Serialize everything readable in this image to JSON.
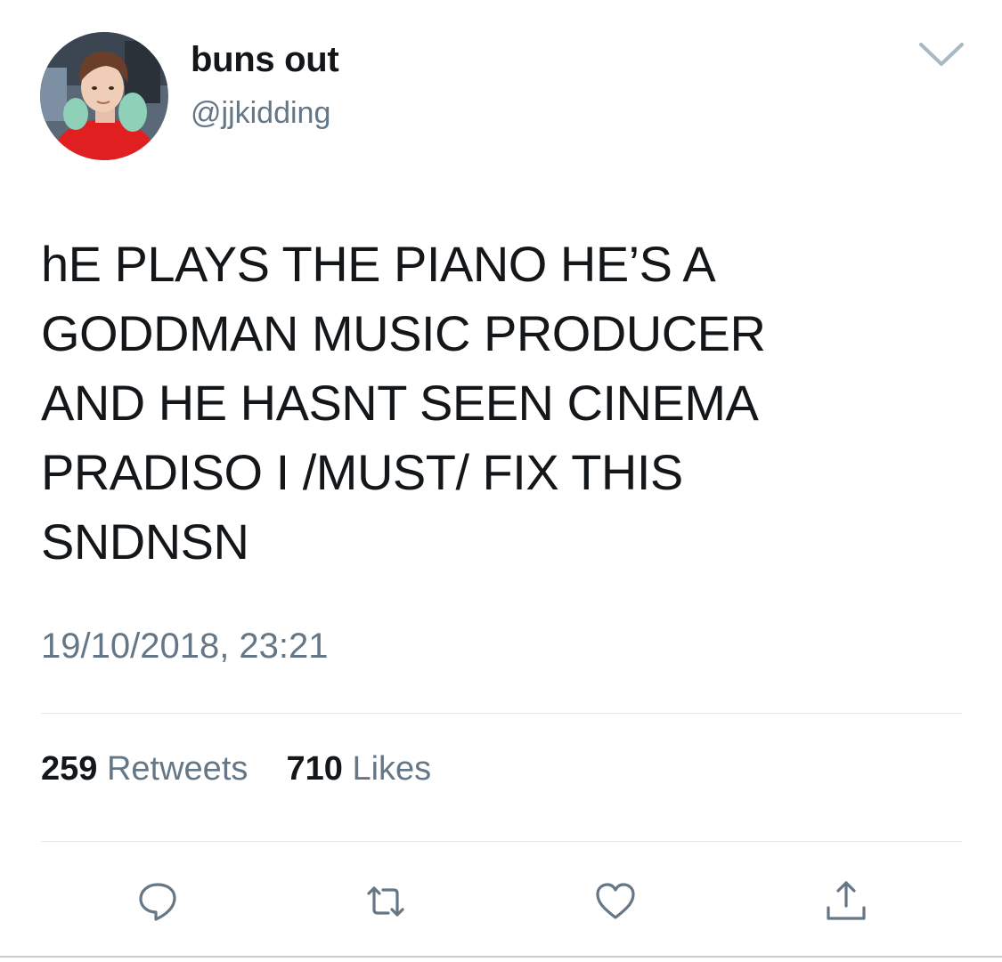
{
  "author": {
    "display_name": "buns out",
    "handle": "@jjkidding"
  },
  "tweet": {
    "text": "hE PLAYS THE PIANO HE’S A\nGODDMAN MUSIC PRODUCER\nAND HE HASNT SEEN CINEMA\nPRADISO I /MUST/ FIX THIS\nSNDNSN",
    "timestamp": "19/10/2018, 23:21"
  },
  "stats": {
    "retweets_count": "259",
    "retweets_label": "Retweets",
    "likes_count": "710",
    "likes_label": "Likes"
  },
  "actions": [
    {
      "icon": "reply-icon"
    },
    {
      "icon": "retweet-icon"
    },
    {
      "icon": "heart-icon"
    },
    {
      "icon": "share-icon"
    }
  ],
  "colors": {
    "text_primary": "#14171a",
    "text_secondary": "#657786",
    "divider": "#e1e8ed",
    "icon": "#657786"
  }
}
